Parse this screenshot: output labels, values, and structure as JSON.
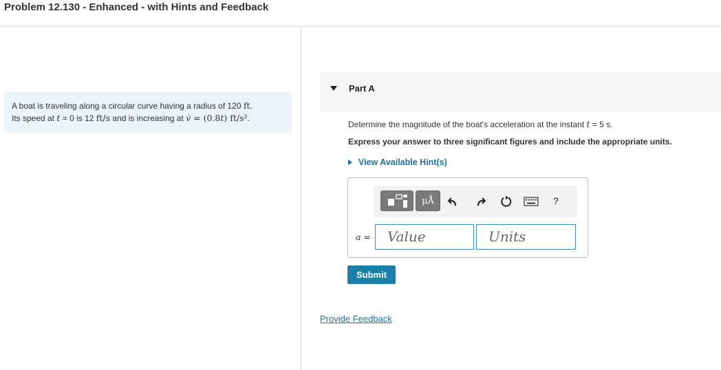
{
  "header": {
    "title": "Problem 12.130 - Enhanced - with Hints and Feedback"
  },
  "problem": {
    "line1_prefix": "A boat is traveling along a circular curve having a radius of 120 ",
    "line1_unit": "ft",
    "line1_end": ".",
    "line2_a": "Its speed at ",
    "line2_var_t": "t",
    "line2_b": " = 0 is 12 ",
    "line2_unit": "ft/s",
    "line2_c": " and is increasing at ",
    "line2_vdot": "v̇",
    "line2_expr": " = (0.8",
    "line2_t2": "t",
    "line2_expr_end": ") ft/s²",
    "line2_end": "."
  },
  "part": {
    "label": "Part A",
    "question_a": "Determine the magnitude of the boat's acceleration at the instant ",
    "question_var": "t",
    "question_b": " = 5 s.",
    "instruction": "Express your answer to three significant figures and include the appropriate units.",
    "hint_label": "View Available Hint(s)"
  },
  "answer": {
    "var_label": "a =",
    "value_placeholder": "Value",
    "units_placeholder": "Units",
    "units_button": "μÅ",
    "help_button": "?"
  },
  "submit_label": "Submit",
  "feedback_link": "Provide Feedback",
  "colors": {
    "link": "#1a73a7",
    "submit": "#1b7fa8",
    "problem_bg": "#e8f4f8",
    "field_border": "#3a8fc0"
  }
}
